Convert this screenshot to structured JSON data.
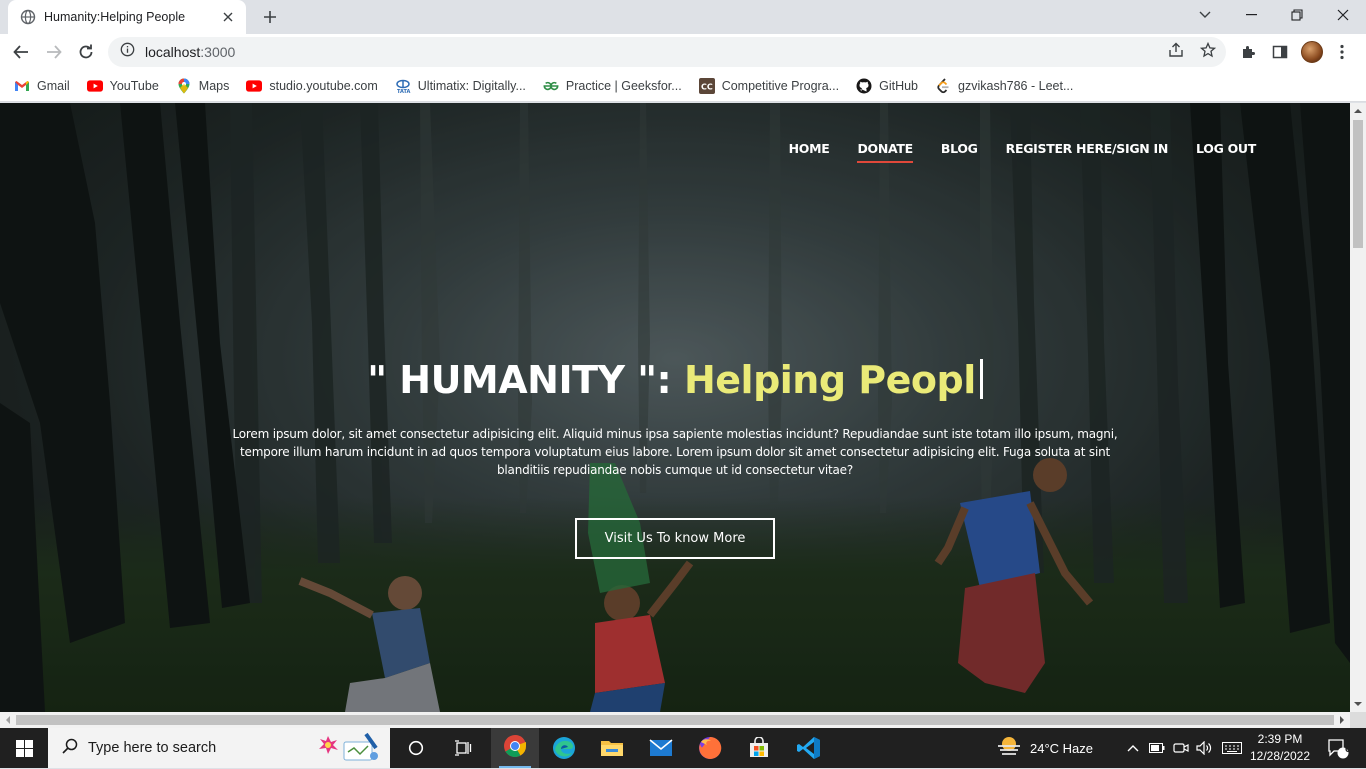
{
  "browser": {
    "tab_title": "Humanity:Helping People",
    "url_host": "localhost",
    "url_port": ":3000",
    "bookmarks": [
      {
        "label": "Gmail",
        "icon": "gmail-icon"
      },
      {
        "label": "YouTube",
        "icon": "youtube-icon"
      },
      {
        "label": "Maps",
        "icon": "maps-icon"
      },
      {
        "label": "studio.youtube.com",
        "icon": "youtube-studio-icon"
      },
      {
        "label": "Ultimatix: Digitally...",
        "icon": "tata-icon"
      },
      {
        "label": "Practice | Geeksfor...",
        "icon": "geeksforgeeks-icon"
      },
      {
        "label": "Competitive Progra...",
        "icon": "codechef-icon"
      },
      {
        "label": "GitHub",
        "icon": "github-icon"
      },
      {
        "label": "gzvikash786 - Leet...",
        "icon": "leetcode-icon"
      }
    ]
  },
  "site": {
    "nav": [
      {
        "label": "HOME",
        "active": false
      },
      {
        "label": "DONATE",
        "active": true
      },
      {
        "label": "BLOG",
        "active": false
      },
      {
        "label": "REGISTER HERE/SIGN IN",
        "active": false
      },
      {
        "label": "LOG OUT",
        "active": false
      }
    ],
    "hero": {
      "title_static": "\" HUMANITY \": ",
      "title_typed": "Helping Peopl",
      "paragraph": "Lorem ipsum dolor, sit amet consectetur adipisicing elit. Aliquid minus ipsa sapiente molestias incidunt? Repudiandae sunt iste totam illo ipsum, magni, tempore illum harum incidunt in ad quos tempora voluptatum eius labore. Lorem ipsum dolor sit amet consectetur adipisicing elit. Fuga soluta at sint blanditiis repudiandae nobis cumque ut id consectetur vitae?",
      "button": "Visit Us To know More"
    },
    "colors": {
      "typed_text": "#eaea78",
      "nav_active_underline": "#e0483a"
    }
  },
  "taskbar": {
    "search_placeholder": "Type here to search",
    "weather": "24°C  Haze",
    "time": "2:39 PM",
    "date": "12/28/2022",
    "notification_count": "6"
  }
}
